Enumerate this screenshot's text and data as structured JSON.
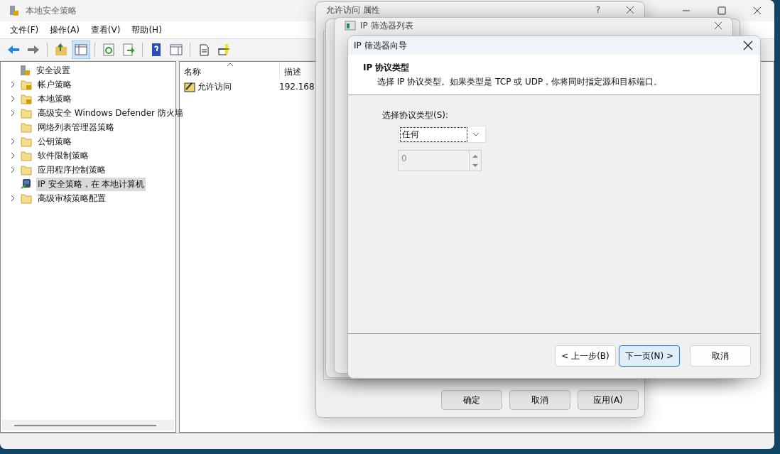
{
  "main_window": {
    "title": "本地安全策略",
    "menu": [
      "文件(F)",
      "操作(A)",
      "查看(V)",
      "帮助(H)"
    ],
    "toolbar": [
      {
        "kind": "back",
        "selected": false
      },
      {
        "kind": "forward",
        "selected": false
      },
      {
        "kind": "separator"
      },
      {
        "kind": "up",
        "selected": false
      },
      {
        "kind": "tree",
        "selected": true
      },
      {
        "kind": "separator"
      },
      {
        "kind": "refresh",
        "selected": false
      },
      {
        "kind": "export",
        "selected": false
      },
      {
        "kind": "separator"
      },
      {
        "kind": "help",
        "selected": false
      },
      {
        "kind": "pane",
        "selected": false
      },
      {
        "kind": "separator"
      },
      {
        "kind": "new",
        "selected": false
      },
      {
        "kind": "add",
        "selected": false
      }
    ],
    "tree": {
      "label": "安全设置",
      "children": [
        {
          "label": "帐户策略",
          "kind": "locked-folder",
          "expandable": true,
          "selected": false
        },
        {
          "label": "本地策略",
          "kind": "locked-folder",
          "expandable": true,
          "selected": false
        },
        {
          "label": "高级安全 Windows Defender 防火墙",
          "kind": "folder",
          "expandable": true,
          "selected": false
        },
        {
          "label": "网络列表管理器策略",
          "kind": "folder",
          "expandable": false,
          "selected": false
        },
        {
          "label": "公钥策略",
          "kind": "folder",
          "expandable": true,
          "selected": false
        },
        {
          "label": "软件限制策略",
          "kind": "folder",
          "expandable": true,
          "selected": false
        },
        {
          "label": "应用程序控制策略",
          "kind": "folder",
          "expandable": true,
          "selected": false
        },
        {
          "label": "IP 安全策略，在 本地计算机",
          "kind": "computer",
          "expandable": false,
          "selected": true
        },
        {
          "label": "高级审核策略配置",
          "kind": "folder",
          "expandable": true,
          "selected": false
        }
      ]
    },
    "list": {
      "columns": [
        {
          "label": "名称",
          "sorted": true
        },
        {
          "label": "描述",
          "sorted": false
        }
      ],
      "rows": [
        {
          "name": "允许访问",
          "description": "192.168"
        }
      ]
    }
  },
  "properties_dialog": {
    "title": "允许访问 属性",
    "help": "?",
    "buttons": [
      "确定",
      "取消",
      "应用(A)"
    ]
  },
  "filter_list_dialog": {
    "title": "IP 筛选器列表"
  },
  "wizard": {
    "title": "IP 筛选器向导",
    "heading": "IP 协议类型",
    "description": "选择 IP 协议类型。如果类型是 TCP 或 UDP，你将同时指定源和目标端口。",
    "protocol_label": "选择协议类型(S):",
    "protocol_value": "任何",
    "port_value": "0",
    "port_disabled": true,
    "buttons": [
      {
        "label": "< 上一步(B)",
        "default": false
      },
      {
        "label": "下一页(N) >",
        "default": true
      },
      {
        "label": "取消",
        "default": false
      }
    ]
  }
}
